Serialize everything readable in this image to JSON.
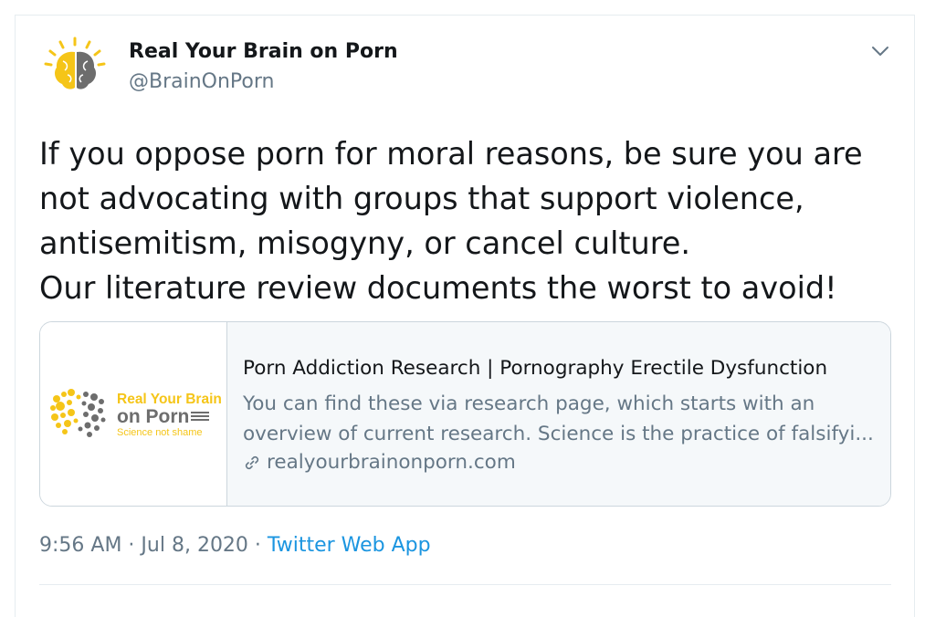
{
  "author": {
    "display_name": "Real Your Brain on Porn",
    "handle": "@BrainOnPorn",
    "avatar_icon": "brain-logo-icon"
  },
  "tweet": {
    "lines": [
      "If you oppose porn for moral reasons, be sure you are",
      "not advocating with groups that support violence,",
      "antisemitism, misogyny, or cancel culture.",
      "Our literature review documents the worst to avoid!"
    ]
  },
  "card": {
    "title": "Porn Addiction Research | Pornography Erectile Dysfunction",
    "description_lines": [
      "You can find these via research page, which starts with an",
      "overview of current research. Science is the practice of falsifyi..."
    ],
    "domain": "realyourbrainonporn.com",
    "thumbnail": {
      "line1": "Real Your Brain",
      "line2": "on Porn",
      "line3": "Science not shame"
    }
  },
  "meta": {
    "time": "9:56 AM",
    "separator1": " · ",
    "date": "Jul 8, 2020",
    "separator2": " · ",
    "source": "Twitter Web App"
  },
  "colors": {
    "text_primary": "#14171a",
    "text_secondary": "#657786",
    "link": "#1b95e0",
    "border": "#ccd6dd",
    "brand_yellow": "#f5c518",
    "brand_gray": "#6d6d6d"
  }
}
